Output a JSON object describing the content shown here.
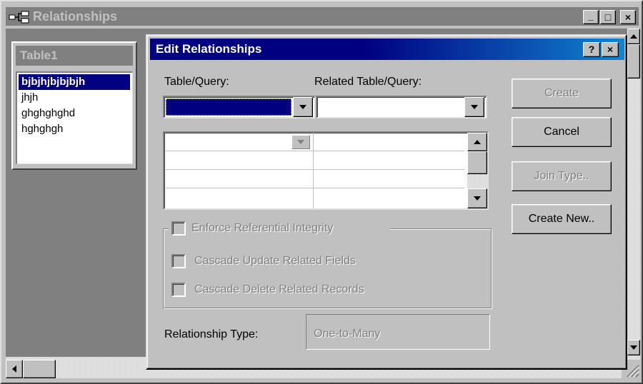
{
  "window": {
    "title": "Relationships",
    "buttons": {
      "minimize": "_",
      "maximize": "□",
      "close": "×"
    }
  },
  "table1": {
    "title": "Table1",
    "fields": [
      "bjbjhjbjbjbjh",
      "jhjh",
      "ghghghghd",
      "hghghgh"
    ],
    "selected_index": 0
  },
  "dialog": {
    "title": "Edit Relationships",
    "help_button": "?",
    "close_button": "×",
    "table_query_label": "Table/Query:",
    "related_table_label": "Related Table/Query:",
    "table_query_value": "",
    "related_table_value": "",
    "buttons": {
      "create": "Create",
      "cancel": "Cancel",
      "join_type": "Join Type..",
      "create_new": "Create New.."
    },
    "enforce_integrity": {
      "label": "Enforce Referential Integrity",
      "checked": false,
      "enabled": false
    },
    "cascade_update": {
      "label": "Cascade Update Related Fields",
      "checked": false,
      "enabled": false
    },
    "cascade_delete": {
      "label": "Cascade Delete Related Records",
      "checked": false,
      "enabled": false
    },
    "relationship_type_label": "Relationship Type:",
    "relationship_type_value": "One-to-Many"
  },
  "colors": {
    "title_active": "#000080",
    "title_gradient_end": "#1084d0",
    "title_inactive": "#808080",
    "face": "#c0c0c0",
    "selection": "#000080"
  }
}
